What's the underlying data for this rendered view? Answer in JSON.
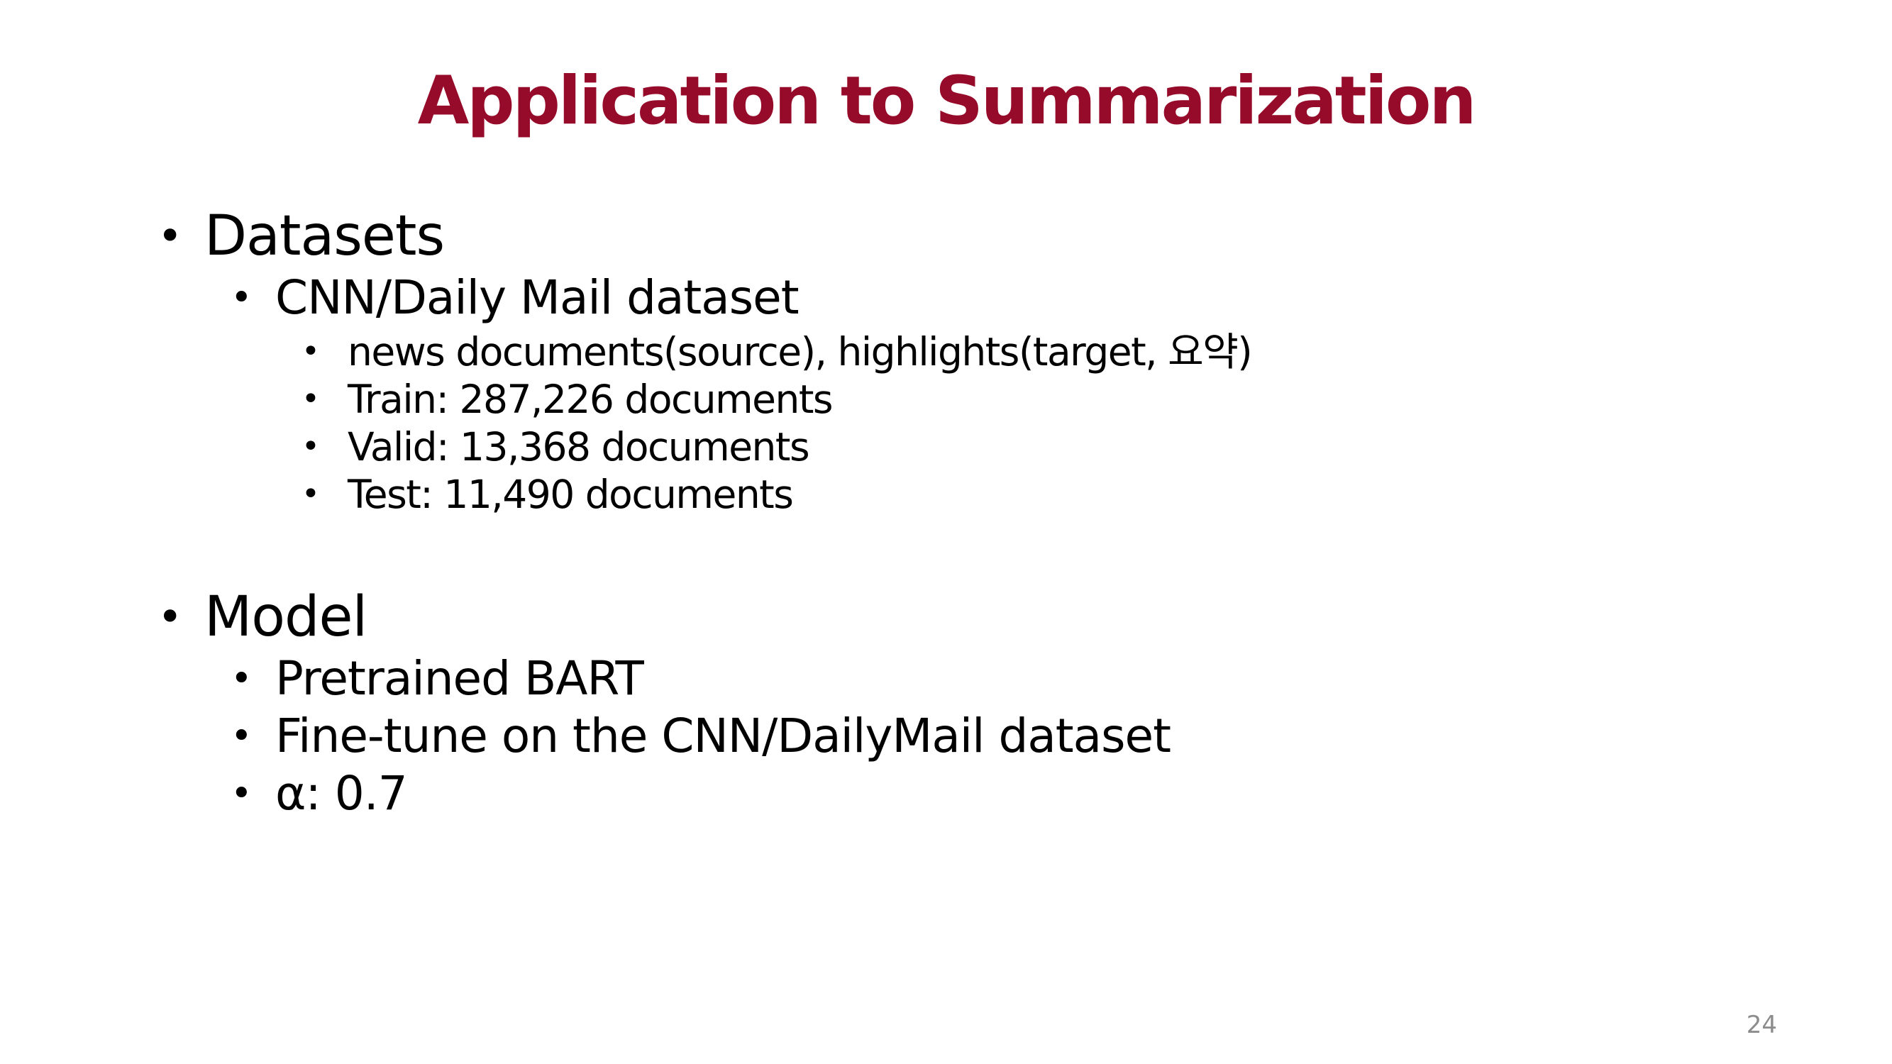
{
  "slide": {
    "title": "Application to Summarization",
    "bullet_glyph": "•",
    "datasets": {
      "label": "Datasets",
      "dataset_name": "CNN/Daily Mail dataset",
      "details": [
        "news documents(source), highlights(target, 요약)",
        "Train: 287,226 documents",
        "Valid: 13,368 documents",
        "Test: 11,490 documents"
      ]
    },
    "model": {
      "label": "Model",
      "items": [
        "Pretrained BART",
        "Fine-tune on the CNN/DailyMail dataset",
        "α: 0.7"
      ]
    },
    "page_number": "24"
  }
}
